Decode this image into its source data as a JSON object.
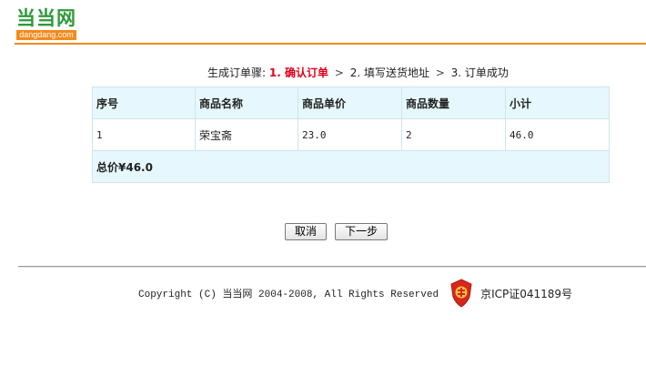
{
  "logo": {
    "text": "当当网",
    "domain": "dangdang.com"
  },
  "steps": {
    "prefix": "生成订单骤:",
    "step1": "1. 确认订单",
    "separator": ">",
    "step2": "2. 填写送货地址",
    "step3": "3. 订单成功"
  },
  "table": {
    "headers": [
      "序号",
      "商品名称",
      "商品单价",
      "商品数量",
      "小计"
    ],
    "rows": [
      [
        "1",
        "荣宝斋",
        "23.0",
        "2",
        "46.0"
      ]
    ],
    "total": "总价¥46.0"
  },
  "buttons": {
    "cancel": "取消",
    "next": "下一步"
  },
  "footer": {
    "copyright": "Copyright (C) 当当网 2004-2008, All Rights Reserved",
    "icp": "京ICP证041189号"
  },
  "colors": {
    "logo_green": "#2f9a3b",
    "accent_orange": "#f28a1b",
    "step_red": "#e0001b",
    "table_header_bg": "#e6f8fd"
  }
}
